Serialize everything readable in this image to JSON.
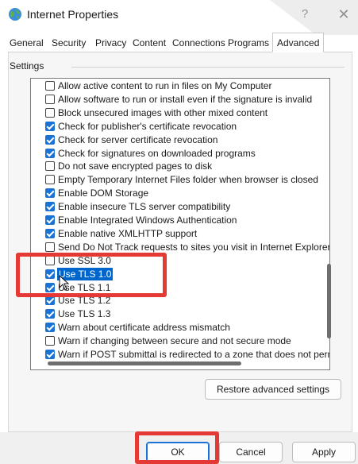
{
  "window": {
    "title": "Internet Properties",
    "help_label": "?",
    "close_label": "✕"
  },
  "tabs": [
    {
      "label": "General"
    },
    {
      "label": "Security"
    },
    {
      "label": "Privacy"
    },
    {
      "label": "Content"
    },
    {
      "label": "Connections"
    },
    {
      "label": "Programs"
    },
    {
      "label": "Advanced"
    }
  ],
  "settings": {
    "group_label": "Settings",
    "items": [
      {
        "label": "Allow active content to run in files on My Computer",
        "checked": false
      },
      {
        "label": "Allow software to run or install even if the signature is invalid",
        "checked": false
      },
      {
        "label": "Block unsecured images with other mixed content",
        "checked": false
      },
      {
        "label": "Check for publisher's certificate revocation",
        "checked": true
      },
      {
        "label": "Check for server certificate revocation",
        "checked": true
      },
      {
        "label": "Check for signatures on downloaded programs",
        "checked": true
      },
      {
        "label": "Do not save encrypted pages to disk",
        "checked": false
      },
      {
        "label": "Empty Temporary Internet Files folder when browser is closed",
        "checked": false
      },
      {
        "label": "Enable DOM Storage",
        "checked": true
      },
      {
        "label": "Enable insecure TLS server compatibility",
        "checked": true
      },
      {
        "label": "Enable Integrated Windows Authentication",
        "checked": true
      },
      {
        "label": "Enable native XMLHTTP support",
        "checked": true
      },
      {
        "label": "Send Do Not Track requests to sites you visit in Internet Explorer",
        "checked": false
      },
      {
        "label": "Use SSL 3.0",
        "checked": false
      },
      {
        "label": "Use TLS 1.0",
        "checked": true,
        "selected": true
      },
      {
        "label": "Use TLS 1.1",
        "checked": true
      },
      {
        "label": "Use TLS 1.2",
        "checked": true
      },
      {
        "label": "Use TLS 1.3",
        "checked": true
      },
      {
        "label": "Warn about certificate address mismatch",
        "checked": true
      },
      {
        "label": "Warn if changing between secure and not secure mode",
        "checked": false
      },
      {
        "label": "Warn if POST submittal is redirected to a zone that does not permit posts",
        "checked": true
      }
    ],
    "restore_label": "Restore advanced settings"
  },
  "buttons": {
    "ok": "OK",
    "cancel": "Cancel",
    "apply": "Apply"
  },
  "colors": {
    "accent": "#1a73d4",
    "selection": "#0066cc",
    "highlight_box": "#e53935"
  },
  "icons": {
    "title": "globe-icon",
    "cursor": "mouse-pointer-icon"
  }
}
